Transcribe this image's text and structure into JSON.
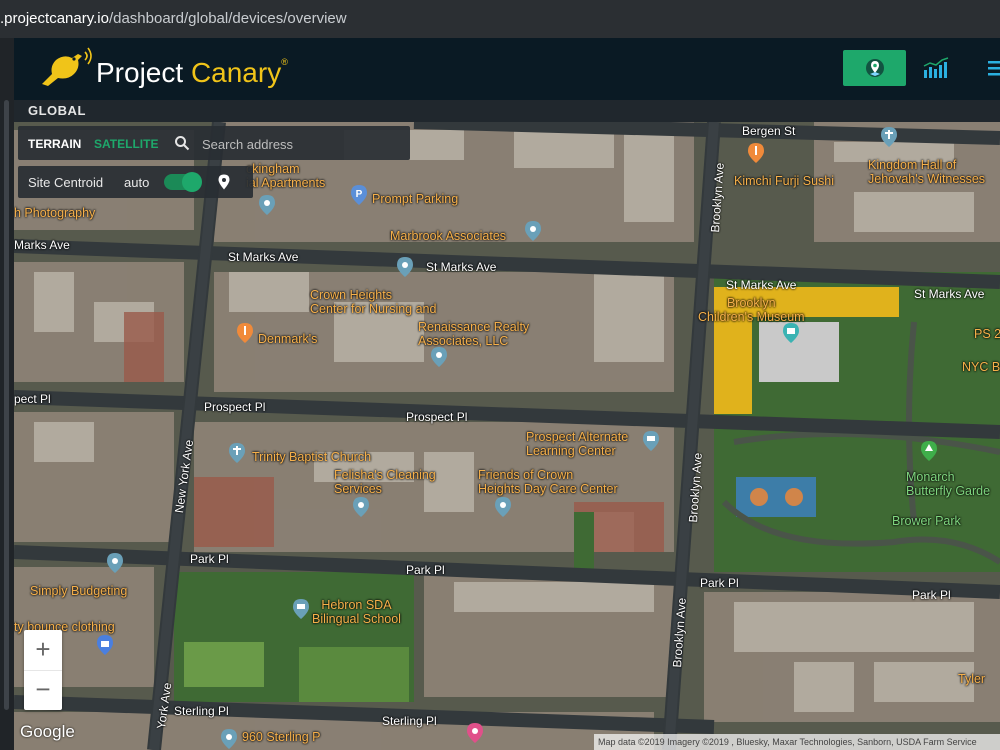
{
  "browser": {
    "url_host": ".projectcanary.io",
    "url_path": "/dashboard/global/devices/overview"
  },
  "header": {
    "brand_main": "Project ",
    "brand_accent": "Canary",
    "brand_mark": "®",
    "nav": [
      {
        "name": "map-view",
        "icon": "location-pin-icon",
        "active": true
      },
      {
        "name": "analytics",
        "icon": "bar-chart-icon",
        "active": false
      },
      {
        "name": "list",
        "icon": "list-icon",
        "active": false
      }
    ]
  },
  "page": {
    "title": "GLOBAL"
  },
  "map_controls": {
    "terrain_label": "TERRAIN",
    "satellite_label": "SATELLITE",
    "search_placeholder": "Search address",
    "site_centroid_label": "Site Centroid",
    "site_centroid_mode": "auto",
    "site_centroid_enabled": true
  },
  "zoom": {
    "in_label": "+",
    "out_label": "−"
  },
  "attribution": {
    "google": "Google",
    "text": "Map data ©2019 Imagery ©2019 , Bluesky, Maxar Technologies, Sanborn, USDA Farm Service"
  },
  "streets": {
    "bergen_st": "Bergen St",
    "st_marks_ave": "St Marks Ave",
    "marks_ave_partial": "Marks Ave",
    "prospect_pl": "Prospect Pl",
    "prospect_pl_partial": "pect Pl",
    "park_pl": "Park Pl",
    "sterling_pl": "Sterling Pl",
    "new_york_ave": "New York Ave",
    "new_york_ave_partial": "York Ave",
    "brooklyn_ave": "Brooklyn Ave"
  },
  "pois": {
    "apartments": "ckingham\nial Apartments",
    "photography": "h Photography",
    "prompt_parking": "Prompt Parking",
    "marbrook": "Marbrook Associates",
    "kimchi": "Kimchi Furji Sushi",
    "kingdom_hall": "Kingdom Hall of\nJehovah's Witnesses",
    "crown_heights_center": "Crown Heights\nCenter for Nursing and",
    "renaissance": "Renaissance Realty\nAssociates, LLC",
    "denmarks": "Denmark's",
    "childrens_museum": "Brooklyn\nChildren's Museum",
    "ps": "PS 2",
    "nyc_bo": "NYC Bo",
    "prospect_alternate": "Prospect Alternate\nLearning Center",
    "trinity": "Trinity Baptist Church",
    "felishas": "Felisha's Cleaning\nServices",
    "friends": "Friends of Crown\nHeights Day Care Center",
    "monarch": "Monarch\nButterfly Garde",
    "brower": "Brower Park",
    "simply_budgeting": "Simply Budgeting",
    "hebron": "Hebron SDA\nBilingual School",
    "bounce": "ty bounce clothing",
    "tyler": "Tyler",
    "sterling_960": "960 Sterling P"
  },
  "colors": {
    "accent": "#1ea86b",
    "brand_yellow": "#f0c419",
    "header_bg": "#0a1a24",
    "poi_orange": "#f6b04a"
  }
}
